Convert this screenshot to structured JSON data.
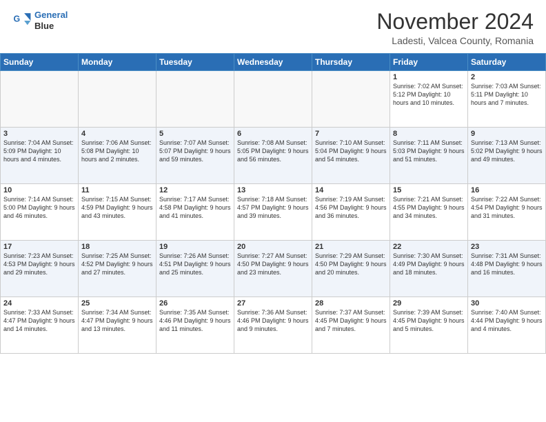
{
  "header": {
    "logo_line1": "General",
    "logo_line2": "Blue",
    "month": "November 2024",
    "location": "Ladesti, Valcea County, Romania"
  },
  "weekdays": [
    "Sunday",
    "Monday",
    "Tuesday",
    "Wednesday",
    "Thursday",
    "Friday",
    "Saturday"
  ],
  "weeks": [
    [
      {
        "day": "",
        "info": ""
      },
      {
        "day": "",
        "info": ""
      },
      {
        "day": "",
        "info": ""
      },
      {
        "day": "",
        "info": ""
      },
      {
        "day": "",
        "info": ""
      },
      {
        "day": "1",
        "info": "Sunrise: 7:02 AM\nSunset: 5:12 PM\nDaylight: 10 hours\nand 10 minutes."
      },
      {
        "day": "2",
        "info": "Sunrise: 7:03 AM\nSunset: 5:11 PM\nDaylight: 10 hours\nand 7 minutes."
      }
    ],
    [
      {
        "day": "3",
        "info": "Sunrise: 7:04 AM\nSunset: 5:09 PM\nDaylight: 10 hours\nand 4 minutes."
      },
      {
        "day": "4",
        "info": "Sunrise: 7:06 AM\nSunset: 5:08 PM\nDaylight: 10 hours\nand 2 minutes."
      },
      {
        "day": "5",
        "info": "Sunrise: 7:07 AM\nSunset: 5:07 PM\nDaylight: 9 hours\nand 59 minutes."
      },
      {
        "day": "6",
        "info": "Sunrise: 7:08 AM\nSunset: 5:05 PM\nDaylight: 9 hours\nand 56 minutes."
      },
      {
        "day": "7",
        "info": "Sunrise: 7:10 AM\nSunset: 5:04 PM\nDaylight: 9 hours\nand 54 minutes."
      },
      {
        "day": "8",
        "info": "Sunrise: 7:11 AM\nSunset: 5:03 PM\nDaylight: 9 hours\nand 51 minutes."
      },
      {
        "day": "9",
        "info": "Sunrise: 7:13 AM\nSunset: 5:02 PM\nDaylight: 9 hours\nand 49 minutes."
      }
    ],
    [
      {
        "day": "10",
        "info": "Sunrise: 7:14 AM\nSunset: 5:00 PM\nDaylight: 9 hours\nand 46 minutes."
      },
      {
        "day": "11",
        "info": "Sunrise: 7:15 AM\nSunset: 4:59 PM\nDaylight: 9 hours\nand 43 minutes."
      },
      {
        "day": "12",
        "info": "Sunrise: 7:17 AM\nSunset: 4:58 PM\nDaylight: 9 hours\nand 41 minutes."
      },
      {
        "day": "13",
        "info": "Sunrise: 7:18 AM\nSunset: 4:57 PM\nDaylight: 9 hours\nand 39 minutes."
      },
      {
        "day": "14",
        "info": "Sunrise: 7:19 AM\nSunset: 4:56 PM\nDaylight: 9 hours\nand 36 minutes."
      },
      {
        "day": "15",
        "info": "Sunrise: 7:21 AM\nSunset: 4:55 PM\nDaylight: 9 hours\nand 34 minutes."
      },
      {
        "day": "16",
        "info": "Sunrise: 7:22 AM\nSunset: 4:54 PM\nDaylight: 9 hours\nand 31 minutes."
      }
    ],
    [
      {
        "day": "17",
        "info": "Sunrise: 7:23 AM\nSunset: 4:53 PM\nDaylight: 9 hours\nand 29 minutes."
      },
      {
        "day": "18",
        "info": "Sunrise: 7:25 AM\nSunset: 4:52 PM\nDaylight: 9 hours\nand 27 minutes."
      },
      {
        "day": "19",
        "info": "Sunrise: 7:26 AM\nSunset: 4:51 PM\nDaylight: 9 hours\nand 25 minutes."
      },
      {
        "day": "20",
        "info": "Sunrise: 7:27 AM\nSunset: 4:50 PM\nDaylight: 9 hours\nand 23 minutes."
      },
      {
        "day": "21",
        "info": "Sunrise: 7:29 AM\nSunset: 4:50 PM\nDaylight: 9 hours\nand 20 minutes."
      },
      {
        "day": "22",
        "info": "Sunrise: 7:30 AM\nSunset: 4:49 PM\nDaylight: 9 hours\nand 18 minutes."
      },
      {
        "day": "23",
        "info": "Sunrise: 7:31 AM\nSunset: 4:48 PM\nDaylight: 9 hours\nand 16 minutes."
      }
    ],
    [
      {
        "day": "24",
        "info": "Sunrise: 7:33 AM\nSunset: 4:47 PM\nDaylight: 9 hours\nand 14 minutes."
      },
      {
        "day": "25",
        "info": "Sunrise: 7:34 AM\nSunset: 4:47 PM\nDaylight: 9 hours\nand 13 minutes."
      },
      {
        "day": "26",
        "info": "Sunrise: 7:35 AM\nSunset: 4:46 PM\nDaylight: 9 hours\nand 11 minutes."
      },
      {
        "day": "27",
        "info": "Sunrise: 7:36 AM\nSunset: 4:46 PM\nDaylight: 9 hours\nand 9 minutes."
      },
      {
        "day": "28",
        "info": "Sunrise: 7:37 AM\nSunset: 4:45 PM\nDaylight: 9 hours\nand 7 minutes."
      },
      {
        "day": "29",
        "info": "Sunrise: 7:39 AM\nSunset: 4:45 PM\nDaylight: 9 hours\nand 5 minutes."
      },
      {
        "day": "30",
        "info": "Sunrise: 7:40 AM\nSunset: 4:44 PM\nDaylight: 9 hours\nand 4 minutes."
      }
    ]
  ]
}
